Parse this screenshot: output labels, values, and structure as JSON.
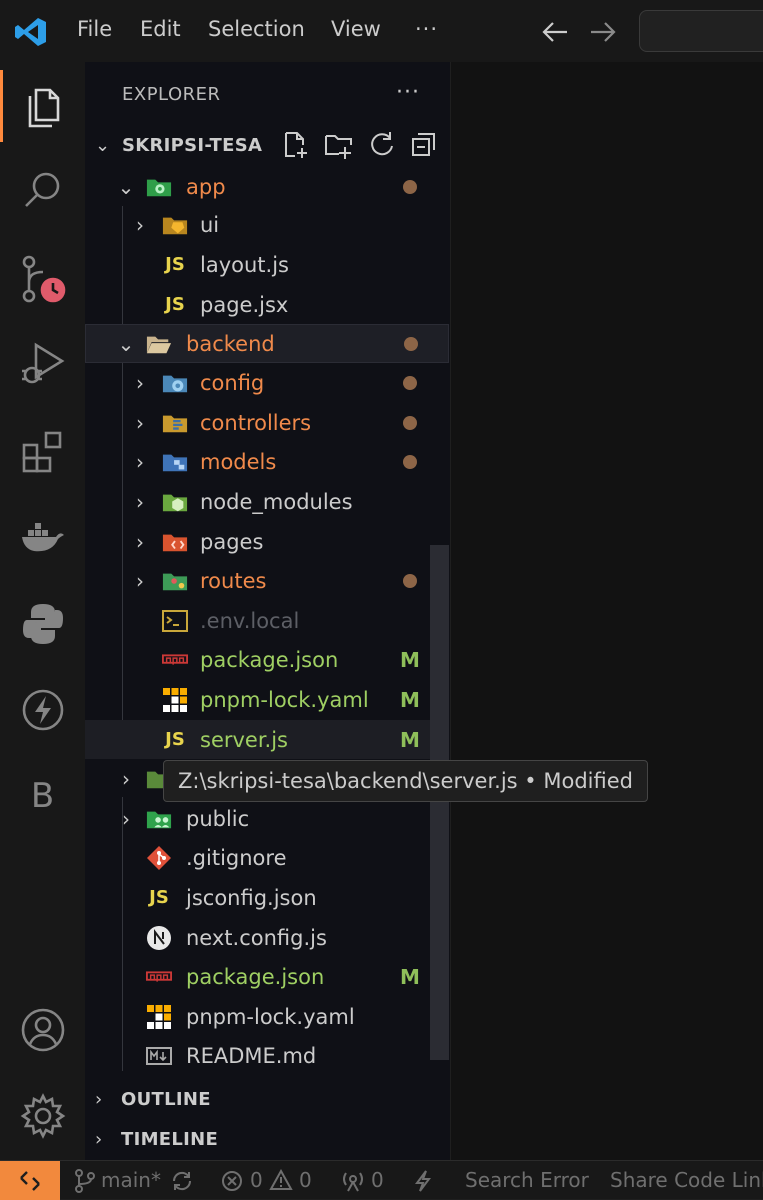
{
  "menubar": {
    "items": [
      "File",
      "Edit",
      "Selection",
      "View"
    ],
    "more": "···"
  },
  "explorer": {
    "title": "EXPLORER",
    "more": "···",
    "root": "SKRIPSI-TESA"
  },
  "tree": [
    {
      "label": "app",
      "color": "orange",
      "expanded": true,
      "dot": true
    },
    {
      "label": "ui",
      "color": "white"
    },
    {
      "label": "layout.js",
      "color": "white"
    },
    {
      "label": "page.jsx",
      "color": "white"
    },
    {
      "label": "backend",
      "color": "orange",
      "expanded": true,
      "dot": true
    },
    {
      "label": "config",
      "color": "orange",
      "dot": true
    },
    {
      "label": "controllers",
      "color": "orange",
      "dot": true
    },
    {
      "label": "models",
      "color": "orange",
      "dot": true
    },
    {
      "label": "node_modules",
      "color": "white"
    },
    {
      "label": "pages",
      "color": "white"
    },
    {
      "label": "routes",
      "color": "orange",
      "dot": true
    },
    {
      "label": ".env.local",
      "color": "gray"
    },
    {
      "label": "package.json",
      "color": "green",
      "badge": "M"
    },
    {
      "label": "pnpm-lock.yaml",
      "color": "green",
      "badge": "M"
    },
    {
      "label": "server.js",
      "color": "green",
      "badge": "M"
    },
    {
      "label": "public",
      "color": "white"
    },
    {
      "label": ".gitignore",
      "color": "white"
    },
    {
      "label": "jsconfig.json",
      "color": "white"
    },
    {
      "label": "next.config.js",
      "color": "white"
    },
    {
      "label": "package.json",
      "color": "green",
      "badge": "M"
    },
    {
      "label": "pnpm-lock.yaml",
      "color": "white"
    },
    {
      "label": "README.md",
      "color": "white"
    }
  ],
  "tooltip": "Z:\\skripsi-tesa\\backend\\server.js • Modified",
  "sections": {
    "outline": "OUTLINE",
    "timeline": "TIMELINE"
  },
  "statusbar": {
    "branch": "main*",
    "errors": "0",
    "warnings": "0",
    "ports": "0",
    "search_error": "Search Error",
    "share": "Share Code Link"
  },
  "activity_bar_letter": "B",
  "colors": {
    "accent": "#f2893d",
    "modified": "#9fcf63",
    "folder_modified": "#f08a4b"
  }
}
